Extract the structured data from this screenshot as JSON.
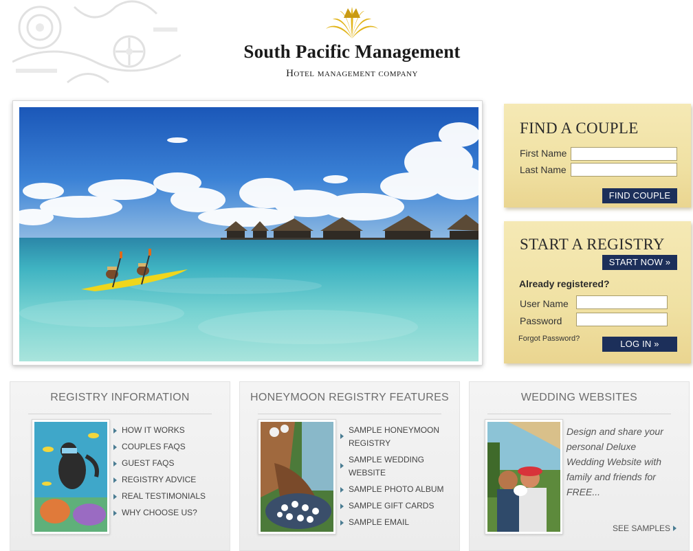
{
  "header": {
    "brand_name": "South Pacific Management",
    "brand_sub": "Hotel management company"
  },
  "find_couple": {
    "title": "FIND A COUPLE",
    "first_name_label": "First Name",
    "last_name_label": "Last Name",
    "first_name_value": "",
    "last_name_value": "",
    "button_label": "FIND COUPLE"
  },
  "registry": {
    "title": "START A REGISTRY",
    "start_button_label": "START NOW »",
    "already_text": "Already registered?",
    "username_label": "User Name",
    "password_label": "Password",
    "username_value": "",
    "password_value": "",
    "forgot_text": "Forgot Password?",
    "login_button_label": "LOG IN »"
  },
  "registry_info": {
    "title": "REGISTRY INFORMATION",
    "links": [
      "HOW IT WORKS",
      "COUPLES FAQS",
      "GUEST FAQS",
      "REGISTRY ADVICE",
      "REAL TESTIMONIALS",
      "WHY CHOOSE US?"
    ]
  },
  "honeymoon_features": {
    "title": "HONEYMOON REGISTRY FEATURES",
    "links": [
      "SAMPLE HONEYMOON REGISTRY",
      "SAMPLE WEDDING WEBSITE",
      "SAMPLE PHOTO ALBUM",
      "SAMPLE GIFT CARDS",
      "SAMPLE EMAIL"
    ]
  },
  "wedding_websites": {
    "title": "WEDDING WEBSITES",
    "tagline": "Design and share your personal Deluxe Wedding Website with family and friends for FREE...",
    "see_samples": "SEE SAMPLES"
  },
  "colors": {
    "panel_bg": "#f0e1a3",
    "button_navy": "#1c2f5a",
    "link_arrow": "#4a7c92",
    "logo_gold": "#e2b51c"
  },
  "icons": {
    "logo": "gold-fan-logo-icon",
    "list_bullet": "triangle-right-icon"
  }
}
